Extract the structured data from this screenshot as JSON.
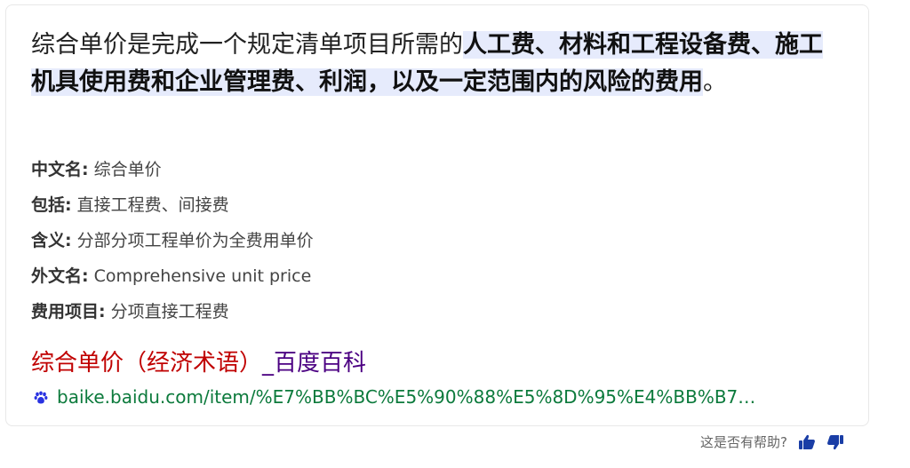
{
  "answer": {
    "prefix": "综合单价是完成一个规定清单项目所需的",
    "highlight": "人工费、材料和工程设备费、施工机具使用费和企业管理费、利润，以及一定范围内的风险的费用",
    "suffix": "。"
  },
  "facts": [
    {
      "key": "中文名:",
      "value": "综合单价"
    },
    {
      "key": "包括:",
      "value": "直接工程费、间接费"
    },
    {
      "key": "含义:",
      "value": "分部分项工程单价为全费用单价"
    },
    {
      "key": "外文名:",
      "value": "Comprehensive unit price"
    },
    {
      "key": "费用项目:",
      "value": "分项直接工程费"
    }
  ],
  "result": {
    "title_main": "综合单价（经济术语）",
    "title_suffix": "_百度百科",
    "url": "baike.baidu.com/item/%E7%BB%BC%E5%90%88%E5%8D%95%E4%BB%B7…",
    "favicon_icon": "baidu-paw-icon"
  },
  "feedback": {
    "label": "这是否有帮助?",
    "up_icon": "thumbs-up-icon",
    "down_icon": "thumbs-down-icon",
    "icon_color": "#1a3ea6"
  }
}
